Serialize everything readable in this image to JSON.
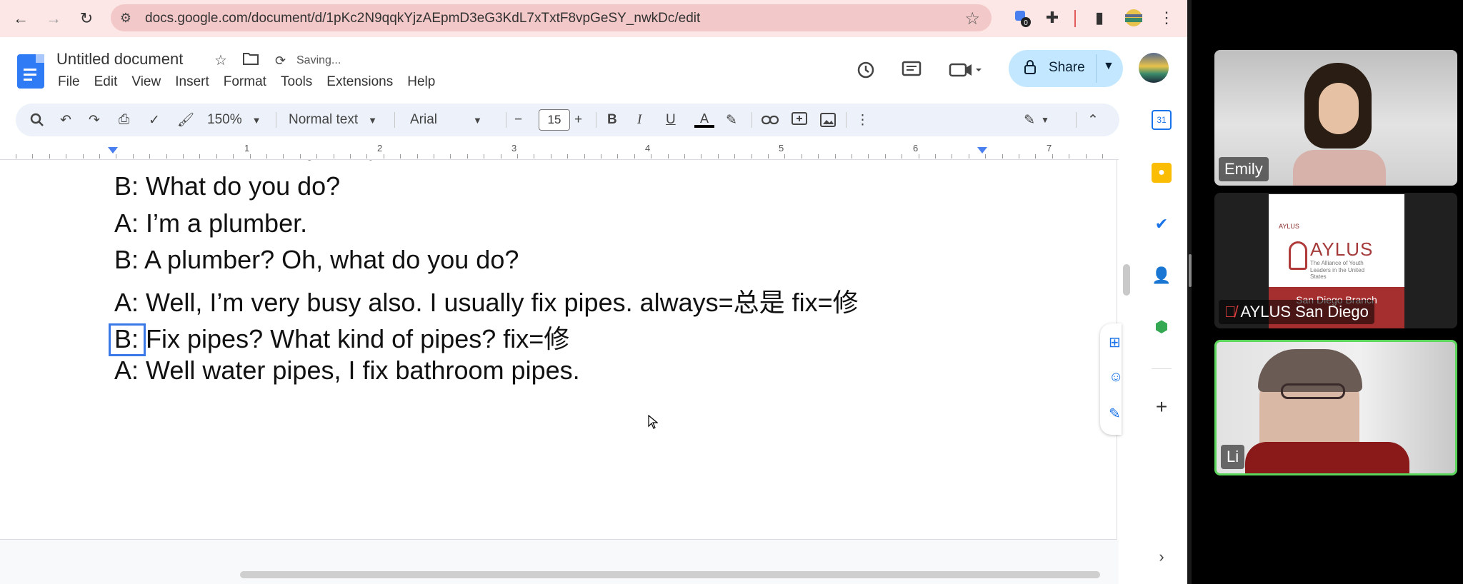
{
  "browser": {
    "url": "docs.google.com/document/d/1pKc2N9qqkYjzAEpmD3eG3KdL7xTxtF8vpGeSY_nwkDc/edit"
  },
  "doc": {
    "title": "Untitled document",
    "saving": "Saving...",
    "menu": [
      "File",
      "Edit",
      "View",
      "Insert",
      "Format",
      "Tools",
      "Extensions",
      "Help"
    ],
    "share_label": "Share"
  },
  "toolbar": {
    "zoom": "150%",
    "style": "Normal text",
    "font": "Arial",
    "font_size": "15"
  },
  "ruler": [
    "1",
    "2",
    "3",
    "4",
    "5",
    "6",
    "7"
  ],
  "lines": [
    "B: What do you do?",
    "A: I’m a plumber.",
    "B: A plumber? Oh, what do you do?",
    "A: Well, I’m very busy also. I usually fix pipes. always=总是 fix=修",
    "B: Fix pipes? What kind of pipes?  fix=修",
    "A: Well water pipes, I fix bathroom pipes."
  ],
  "participants": {
    "emily": "Emily",
    "aylus": "AYLUS San Diego",
    "li": "Li"
  },
  "aylus_card": {
    "logo": "AYLUS",
    "top_small": "AYLUS",
    "tagline": "The Alliance of Youth Leaders in the United States",
    "branch": "San Diego Branch"
  },
  "colors": {
    "accent": "#1a73e8",
    "share_bg": "#c2e7ff",
    "active_speaker": "#5cd65c"
  }
}
